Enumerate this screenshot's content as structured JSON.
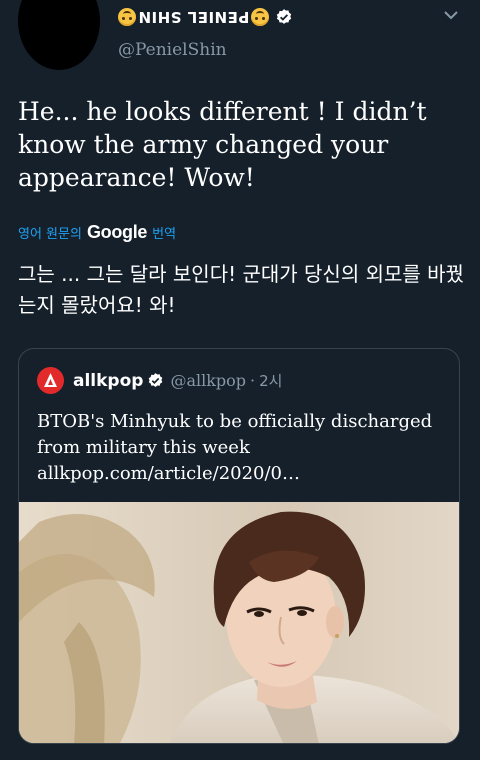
{
  "author": {
    "display_name": "PENIEL SHIN",
    "handle": "@PenielShin",
    "name_emoji": "upside-down-face-emoji",
    "verified_icon": "verified-badge-icon"
  },
  "tweet": {
    "text": "He... he looks different ! I didn’t know the army changed your appearance! Wow!"
  },
  "translation": {
    "language_label": "영어 원문의",
    "provider": "Google",
    "action_label": "번역",
    "text": "그는 ... 그는 달라 보인다! 군대가 당신의 외모를 바꿨는지 몰랐어요! 와!"
  },
  "quoted_tweet": {
    "name": "allkpop",
    "handle": "@allkpop",
    "separator": "·",
    "time": "2시",
    "text": "BTOB's Minhyuk to be officially discharged from military this week",
    "link": "allkpop.com/article/2020/0…",
    "logo_icon": "allkpop-logo-icon",
    "media_description_icon": "photo"
  },
  "colors": {
    "background": "#15202b",
    "accent": "#1da1f2",
    "secondary_text": "#8899a6",
    "border": "#38444d"
  }
}
